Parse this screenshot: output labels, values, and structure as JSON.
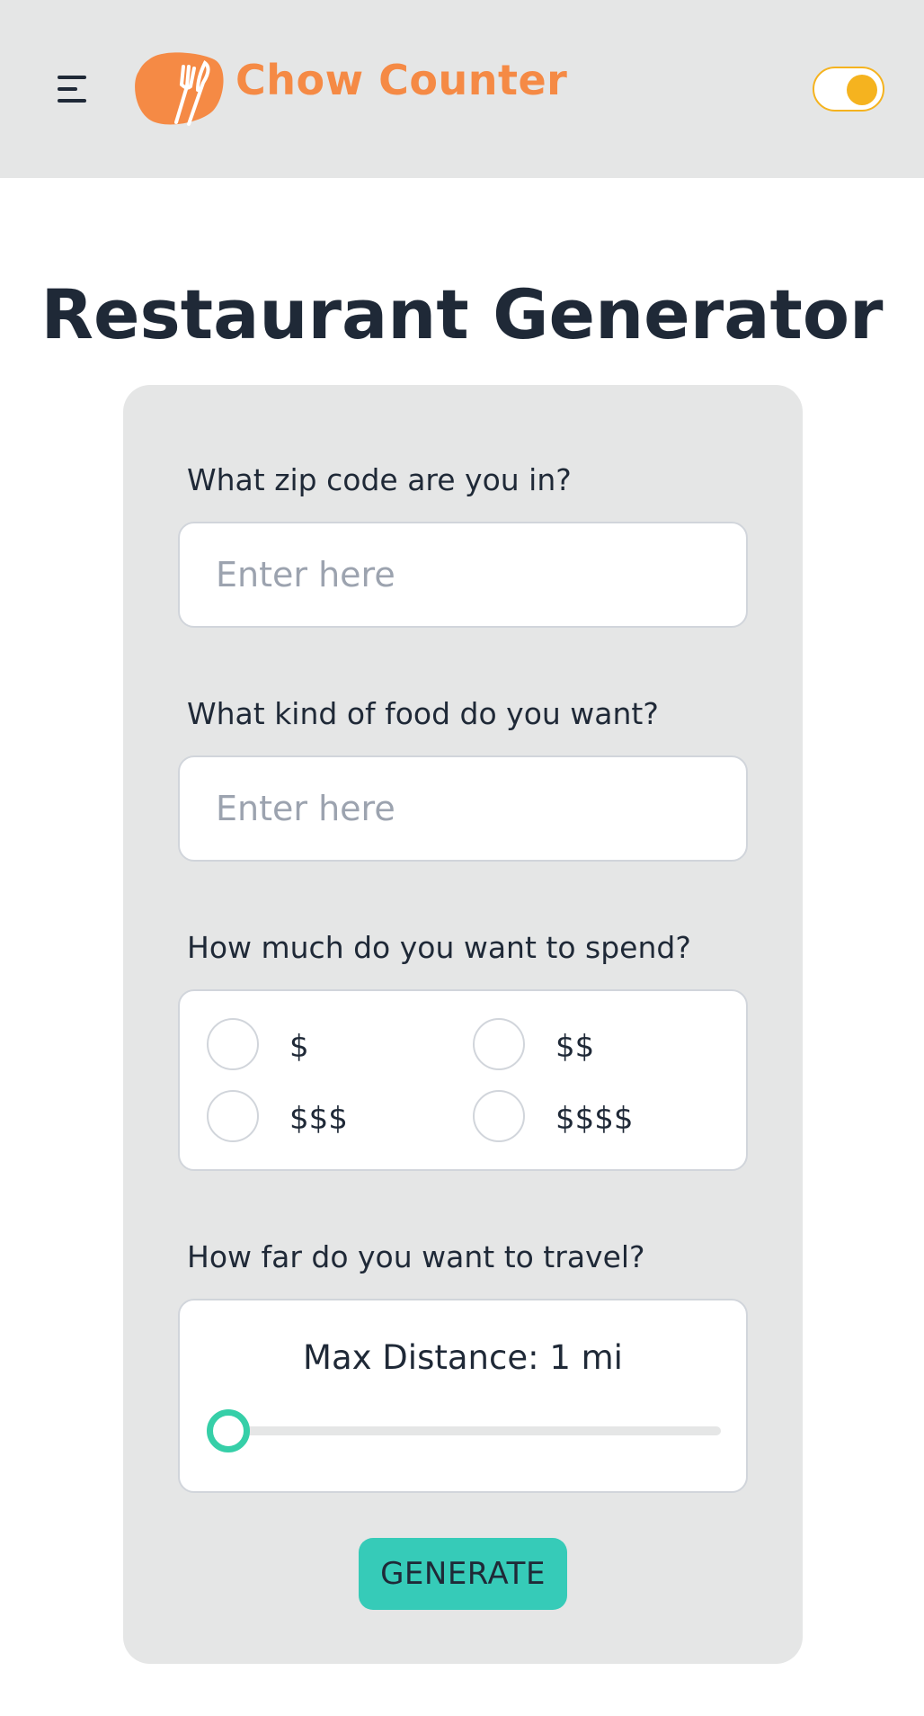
{
  "navbar": {
    "menu_icon": "hamburger-menu-icon",
    "logo_icon": "fork-knife-logo-icon",
    "app_title": "Chow Counter",
    "theme_toggle": {
      "state": "on",
      "accent": "#f5b31f"
    }
  },
  "page": {
    "title": "Restaurant Generator"
  },
  "form": {
    "zip": {
      "label": "What zip code are you in?",
      "placeholder": "Enter here",
      "value": ""
    },
    "food": {
      "label": "What kind of food do you want?",
      "placeholder": "Enter here",
      "value": ""
    },
    "price": {
      "label": "How much do you want to spend?",
      "options": [
        "$",
        "$$",
        "$$$",
        "$$$$"
      ],
      "selected": null
    },
    "distance": {
      "label": "How far do you want to travel?",
      "caption": "Max Distance: 1 mi",
      "value": 1,
      "fraction": 0
    },
    "generate_label": "GENERATE"
  },
  "colors": {
    "navbar_bg": "#e5e6e6",
    "brand": "#f58a45",
    "slider_accent": "#36cfa8",
    "button_bg": "#36cbb8"
  }
}
